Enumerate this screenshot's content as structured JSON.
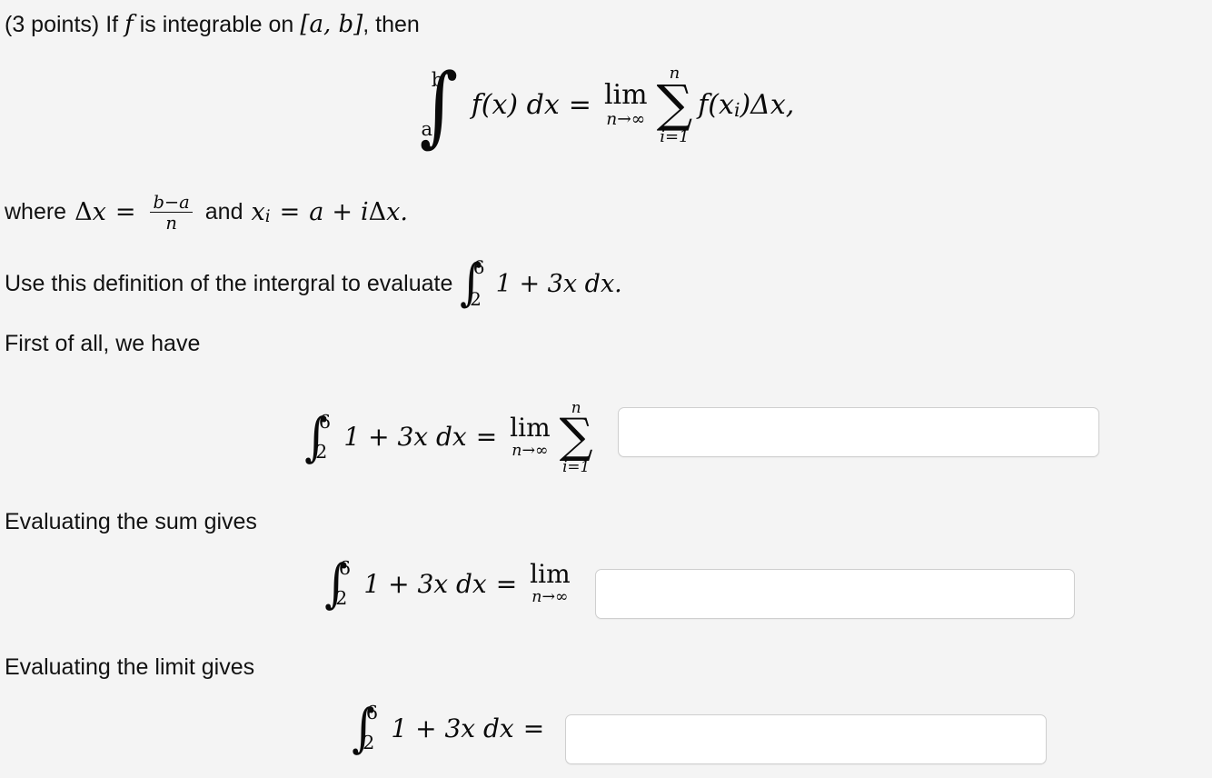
{
  "page": {
    "background_color": "#f4f4f4",
    "text_color": "#121212"
  },
  "problem": {
    "points_label": "(3 points)",
    "intro_text_before_f": "If",
    "intro_f": "f",
    "intro_text_after_f": "is integrable on",
    "interval": "[a, b]",
    "intro_tail": ", then"
  },
  "definition_equation": {
    "integral_lower": "a",
    "integral_upper": "b",
    "integrand": "f(x) dx",
    "equals": "=",
    "limit_op": "lim",
    "limit_sub": "n→∞",
    "sum_glyph": "∑",
    "sum_upper": "n",
    "sum_lower": "i=1",
    "sum_body": "f(x",
    "sum_body_sub": "i",
    "sum_body_tail": ")Δx,"
  },
  "where_line": {
    "lead": "where",
    "delta_x": "Δx",
    "equals1": "=",
    "frac_num": "b−a",
    "frac_den": "n",
    "and": "and",
    "x_sub": "x",
    "x_sub_index": "i",
    "equals2": "=",
    "rhs_a": "a",
    "plus": "+",
    "rhs_idx": "iΔx."
  },
  "instruction_line": {
    "text": "Use this definition of the intergral to evaluate",
    "integral_lower": "2",
    "integral_upper": "6",
    "integrand": "1 + 3x dx."
  },
  "step_labels": {
    "first_of_all": "First of all, we have",
    "evaluating_sum": "Evaluating the sum gives",
    "evaluating_limit": "Evaluating the limit gives"
  },
  "answer_rows": [
    {
      "id": "sum-row",
      "integral_lower": "2",
      "integral_upper": "6",
      "integrand": "1 + 3x dx",
      "equals": "=",
      "limit_op": "lim",
      "limit_sub": "n→∞",
      "sum_glyph": "∑",
      "sum_upper": "n",
      "sum_lower": "i=1",
      "input_value": "",
      "input_placeholder": ""
    },
    {
      "id": "limit-row",
      "integral_lower": "2",
      "integral_upper": "6",
      "integrand": "1 + 3x dx",
      "equals": "=",
      "limit_op": "lim",
      "limit_sub": "n→∞",
      "input_value": "",
      "input_placeholder": ""
    },
    {
      "id": "value-row",
      "integral_lower": "2",
      "integral_upper": "6",
      "integrand": "1 + 3x dx",
      "equals": "=",
      "input_value": "",
      "input_placeholder": ""
    }
  ]
}
